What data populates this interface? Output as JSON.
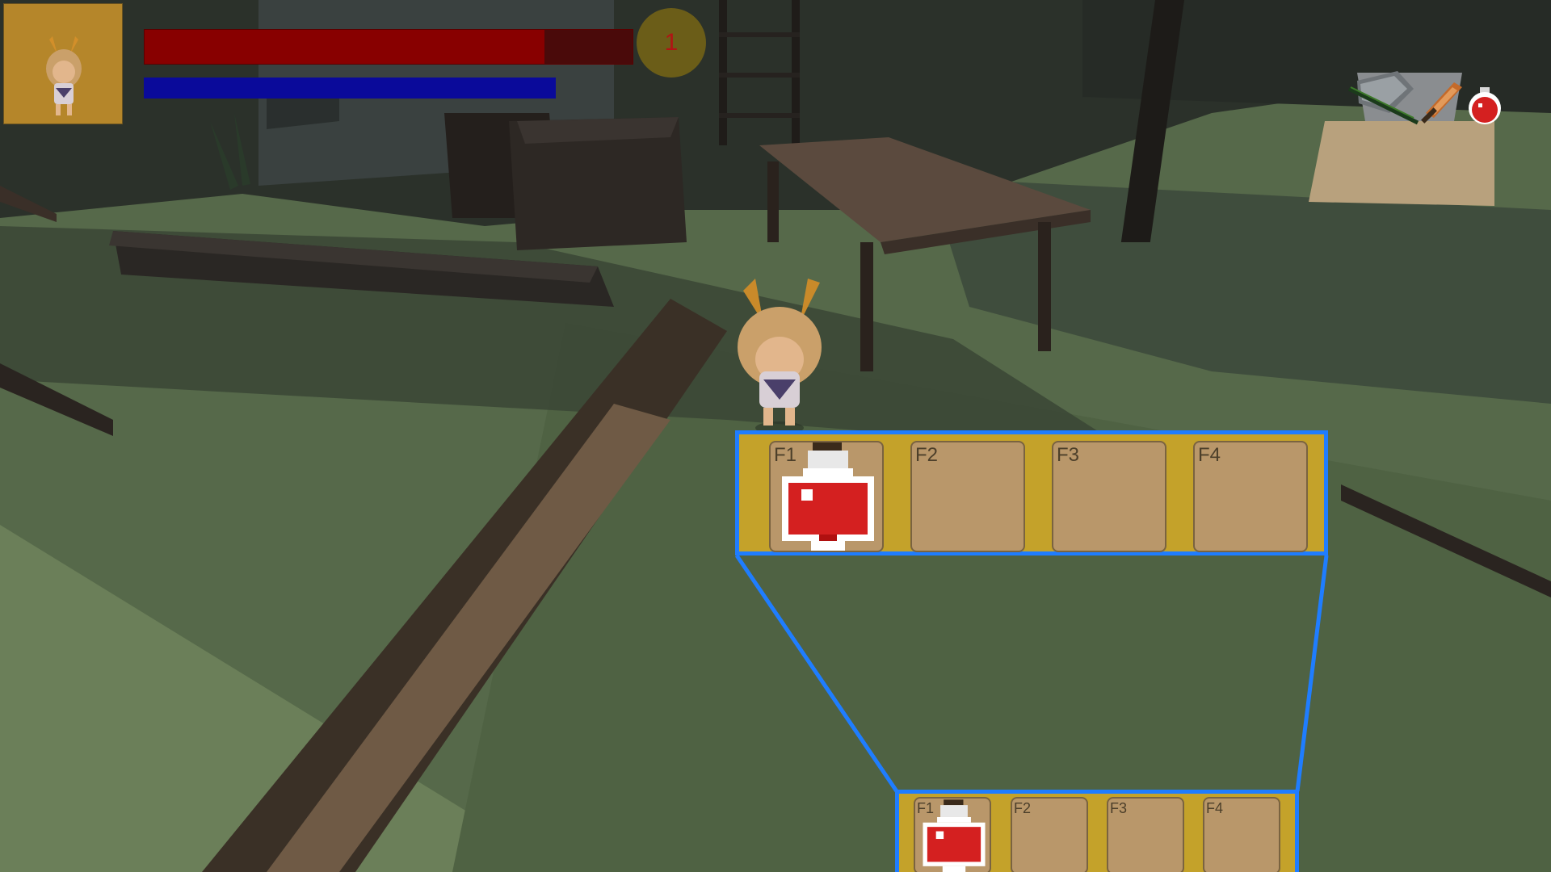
{
  "hud": {
    "level": "1",
    "health": {
      "fraction": 0.82
    },
    "mana": {
      "fraction": 1.0
    },
    "colors": {
      "health": "#880000",
      "mana": "#0a0a9a",
      "level_text": "#b11414"
    }
  },
  "inventory_icons": [
    "shield-icon",
    "sword-icon",
    "potion-icon"
  ],
  "hotbar": {
    "slots": [
      {
        "key": "F1",
        "item": "red-potion-icon"
      },
      {
        "key": "F2",
        "item": ""
      },
      {
        "key": "F3",
        "item": ""
      },
      {
        "key": "F4",
        "item": ""
      }
    ],
    "highlight_color": "#1f7dff"
  }
}
